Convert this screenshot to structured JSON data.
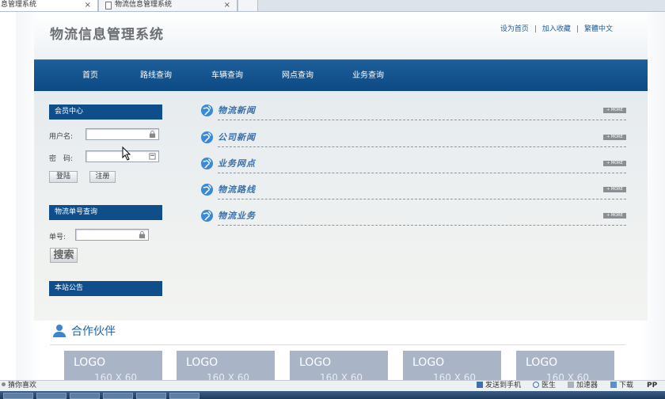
{
  "browser": {
    "tabs": [
      {
        "label": "息管理系统",
        "active": true
      },
      {
        "label": "物流信息管理系统",
        "active": false
      },
      {
        "label": "",
        "active": false
      }
    ],
    "close_glyph": "×"
  },
  "header": {
    "site_title": "物流信息管理系统",
    "links": [
      "设为首页",
      "加入收藏",
      "繁體中文"
    ],
    "separator": "|"
  },
  "nav": {
    "items": [
      "首页",
      "路线查询",
      "车辆查询",
      "网点查询",
      "业务查询"
    ]
  },
  "member": {
    "title": "会员中心",
    "username_label": "用户名:",
    "password_label": "密　码:",
    "username_value": "",
    "password_value": "",
    "login_label": "登陆",
    "register_label": "注册"
  },
  "tracking": {
    "title": "物流单号查询",
    "number_label": "单号:",
    "number_value": "",
    "search_label": "搜索"
  },
  "notice": {
    "title": "本站公告"
  },
  "news": {
    "more_label": "+ MORE",
    "sections": [
      "物流新闻",
      "公司新闻",
      "业务网点",
      "物流路线",
      "物流业务"
    ]
  },
  "partners": {
    "title": "合作伙伴",
    "logos": [
      {
        "line1": "LOGO",
        "line2": "160 X 60"
      },
      {
        "line1": "LOGO",
        "line2": "160 X 60"
      },
      {
        "line1": "LOGO",
        "line2": "160 X 60"
      },
      {
        "line1": "LOGO",
        "line2": "160 X 60"
      },
      {
        "line1": "LOGO",
        "line2": "160 X 60"
      }
    ]
  },
  "statusbar": {
    "guess": "猜你喜欢",
    "send_phone": "发送到手机",
    "doctor": "医生",
    "accelerator": "加速器",
    "download": "下载",
    "right_text": "PP"
  },
  "colors": {
    "nav_bg": "#0c4a85",
    "panel_head": "#0f4e8a",
    "link": "#1e5b99",
    "logo_bg": "#a9b4c7"
  }
}
